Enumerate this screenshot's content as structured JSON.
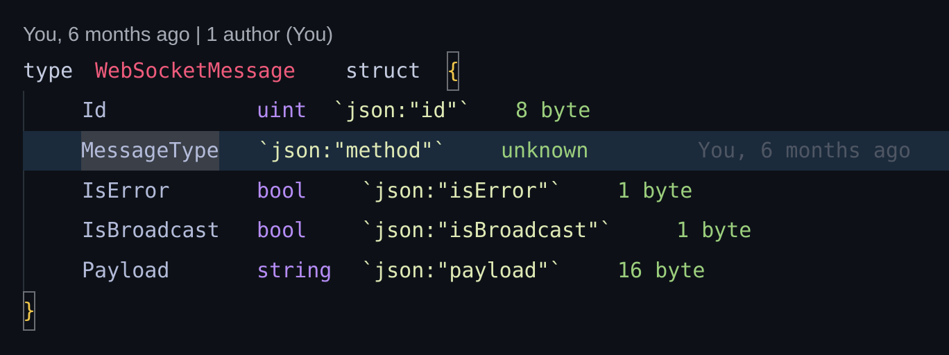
{
  "codelens": {
    "text": "You, 6 months ago | 1 author (You)"
  },
  "code": {
    "decl_keyword": "type",
    "type_name": "WebSocketMessage",
    "struct_keyword": "struct",
    "open_brace": "{",
    "close_brace": "}",
    "fields": [
      {
        "name": "Id",
        "type": "uint",
        "tag": "`json:\"id\"`",
        "hint": "8 byte"
      },
      {
        "name": "MessageType",
        "type": "",
        "tag": "`json:\"method\"`",
        "hint": "unknown",
        "blame": "You, 6 months ago"
      },
      {
        "name": "IsError",
        "type": "bool",
        "tag": "`json:\"isError\"`",
        "hint": "1 byte"
      },
      {
        "name": "IsBroadcast",
        "type": "bool",
        "tag": "`json:\"isBroadcast\"`",
        "hint": "1 byte"
      },
      {
        "name": "Payload",
        "type": "string",
        "tag": "`json:\"payload\"`",
        "hint": "16 byte"
      }
    ]
  },
  "colors": {
    "background": "#0d1117",
    "active_line": "#1b2b3c",
    "type_name": "#ef5b7c",
    "field_type": "#b58cf5",
    "tag": "#dfe9b5",
    "inlay_hint": "#9ccf7d",
    "brace": "#f2c94c"
  }
}
